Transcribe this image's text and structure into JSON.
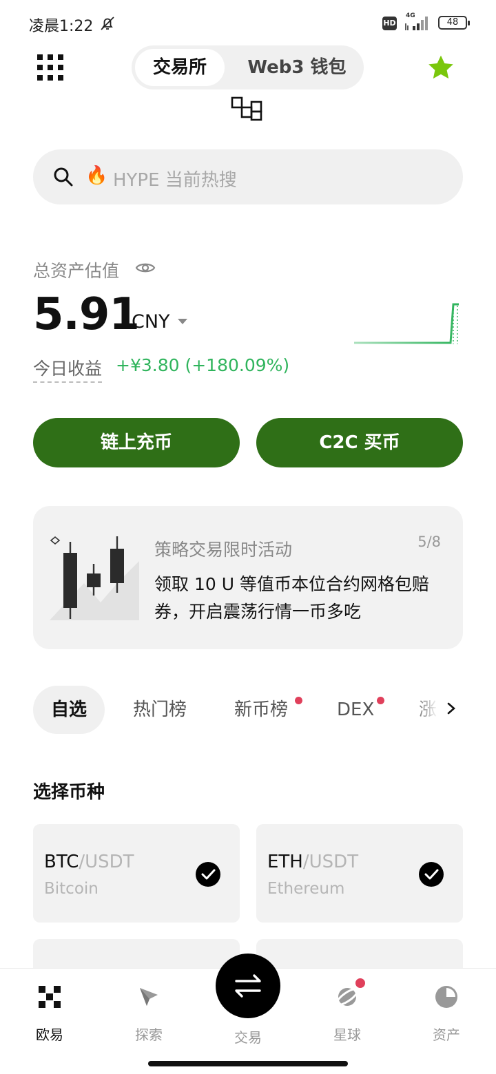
{
  "status_bar": {
    "time": "凌晨1:22",
    "hd": "HD",
    "network": "4G",
    "battery": "48"
  },
  "top_nav": {
    "tabs": [
      {
        "label": "交易所",
        "active": true
      },
      {
        "label": "Web3 钱包",
        "active": false
      }
    ],
    "menu_icon": "grid-menu-icon",
    "favorite_icon": "star-icon",
    "favorite_color": "#7ac70c"
  },
  "search": {
    "placeholder": "HYPE 当前热搜",
    "icon": "search-icon",
    "hot_icon": "fire-icon"
  },
  "assets": {
    "label": "总资产估值",
    "value": "5.91",
    "currency": "CNY",
    "pnl_label": "今日收益",
    "pnl_value": "+¥3.80 (+180.09%)",
    "pnl_color": "#2fb45c"
  },
  "actions": {
    "deposit": "链上充币",
    "c2c": "C2C 买币",
    "color": "#2f6f17"
  },
  "banner": {
    "title": "策略交易限时活动",
    "pager": "5/8",
    "body": "领取 10 U 等值币本位合约网格包赔券，开启震荡行情一币多吃"
  },
  "market_tabs": [
    {
      "label": "自选",
      "active": true,
      "dot": false
    },
    {
      "label": "热门榜",
      "active": false,
      "dot": false
    },
    {
      "label": "新币榜",
      "active": false,
      "dot": true
    },
    {
      "label": "DEX",
      "active": false,
      "dot": true
    },
    {
      "label": "涨",
      "active": false,
      "dot": false
    }
  ],
  "section": {
    "title": "选择币种"
  },
  "coins": [
    {
      "base": "BTC",
      "quote": "/USDT",
      "name": "Bitcoin",
      "selected": true
    },
    {
      "base": "ETH",
      "quote": "/USDT",
      "name": "Ethereum",
      "selected": true
    }
  ],
  "bottom_nav": [
    {
      "label": "欧易",
      "icon": "okx-logo-icon",
      "active": true
    },
    {
      "label": "探索",
      "icon": "compass-icon",
      "active": false
    },
    {
      "label": "交易",
      "icon": "swap-arrows-icon",
      "active": false
    },
    {
      "label": "星球",
      "icon": "planet-icon",
      "active": false,
      "dot": true
    },
    {
      "label": "资产",
      "icon": "pie-chart-icon",
      "active": false
    }
  ]
}
